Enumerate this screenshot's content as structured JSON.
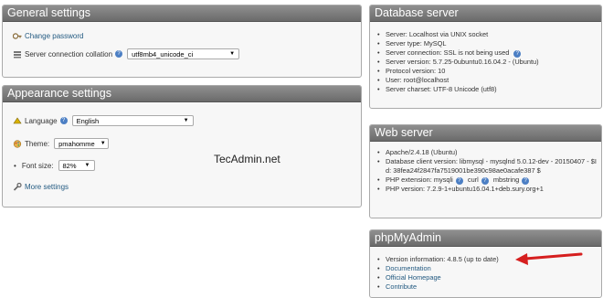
{
  "general": {
    "title": "General settings",
    "change_password": "Change password",
    "collation_label": "Server connection collation",
    "collation_value": "utf8mb4_unicode_ci"
  },
  "appearance": {
    "title": "Appearance settings",
    "language_label": "Language",
    "language_value": "English",
    "theme_label": "Theme:",
    "theme_value": "pmahomme",
    "fontsize_label": "Font size:",
    "fontsize_value": "82%",
    "more_settings": "More settings",
    "watermark": "TecAdmin.net"
  },
  "database_server": {
    "title": "Database server",
    "items": [
      "Server: Localhost via UNIX socket",
      "Server type: MySQL",
      "Server connection: SSL is not being used",
      "Server version: 5.7.25-0ubuntu0.16.04.2 - (Ubuntu)",
      "Protocol version: 10",
      "User: root@localhost",
      "Server charset: UTF-8 Unicode (utf8)"
    ]
  },
  "web_server": {
    "title": "Web server",
    "items": [
      "Apache/2.4.18 (Ubuntu)",
      "Database client version: libmysql - mysqlnd 5.0.12-dev - 20150407 - $Id: 38fea24f2847fa7519001be390c98ae0acafe387 $",
      "PHP extension: mysqli",
      "curl",
      "mbstring",
      "PHP version: 7.2.9-1+ubuntu16.04.1+deb.sury.org+1"
    ]
  },
  "phpmyadmin": {
    "title": "phpMyAdmin",
    "version": "Version information: 4.8.5 (up to date)",
    "links": [
      "Documentation",
      "Official Homepage",
      "Contribute"
    ]
  },
  "colors": {
    "header_gradient_top": "#8f8f8f",
    "header_gradient_bottom": "#6b6b6b",
    "link": "#235a81",
    "arrow": "#d61f1f"
  }
}
